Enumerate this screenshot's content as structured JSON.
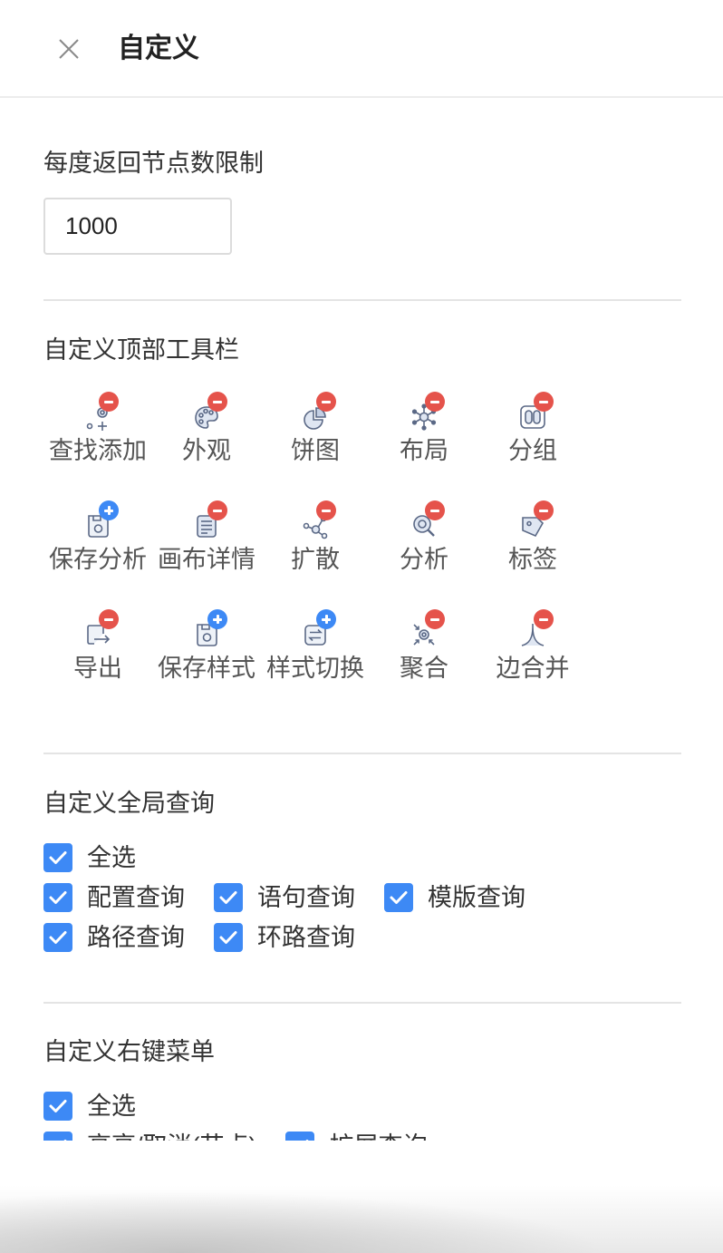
{
  "header": {
    "title": "自定义",
    "close_icon": "close-icon"
  },
  "node_limit": {
    "label": "每度返回节点数限制",
    "value": "1000"
  },
  "toolbar": {
    "label": "自定义顶部工具栏",
    "items": [
      {
        "label": "查找添加",
        "icon": "search-add-icon",
        "badge": "remove"
      },
      {
        "label": "外观",
        "icon": "palette-icon",
        "badge": "remove"
      },
      {
        "label": "饼图",
        "icon": "pie-chart-icon",
        "badge": "remove"
      },
      {
        "label": "布局",
        "icon": "layout-icon",
        "badge": "remove"
      },
      {
        "label": "分组",
        "icon": "group-icon",
        "badge": "remove"
      },
      {
        "label": "保存分析",
        "icon": "save-analysis-icon",
        "badge": "add"
      },
      {
        "label": "画布详情",
        "icon": "canvas-detail-icon",
        "badge": "remove"
      },
      {
        "label": "扩散",
        "icon": "expand-icon",
        "badge": "remove"
      },
      {
        "label": "分析",
        "icon": "analysis-icon",
        "badge": "remove"
      },
      {
        "label": "标签",
        "icon": "tag-icon",
        "badge": "remove"
      },
      {
        "label": "导出",
        "icon": "export-icon",
        "badge": "remove"
      },
      {
        "label": "保存样式",
        "icon": "save-style-icon",
        "badge": "add"
      },
      {
        "label": "样式切换",
        "icon": "style-switch-icon",
        "badge": "add"
      },
      {
        "label": "聚合",
        "icon": "aggregate-icon",
        "badge": "remove"
      },
      {
        "label": "边合并",
        "icon": "edge-merge-icon",
        "badge": "remove"
      }
    ]
  },
  "global_query": {
    "label": "自定义全局查询",
    "select_all": {
      "label": "全选",
      "checked": true
    },
    "options": [
      {
        "label": "配置查询",
        "checked": true
      },
      {
        "label": "语句查询",
        "checked": true
      },
      {
        "label": "模版查询",
        "checked": true
      },
      {
        "label": "路径查询",
        "checked": true
      },
      {
        "label": "环路查询",
        "checked": true
      }
    ]
  },
  "context_menu": {
    "label": "自定义右键菜单",
    "select_all": {
      "label": "全选",
      "checked": true
    },
    "options": [
      {
        "label": "高亮/取消(节点)",
        "checked": true
      },
      {
        "label": "扩展查询",
        "checked": true
      }
    ]
  },
  "colors": {
    "accent": "#3d89f5",
    "remove_badge": "#e5534b",
    "add_badge": "#3d89f5",
    "icon_stroke": "#5b6986"
  }
}
